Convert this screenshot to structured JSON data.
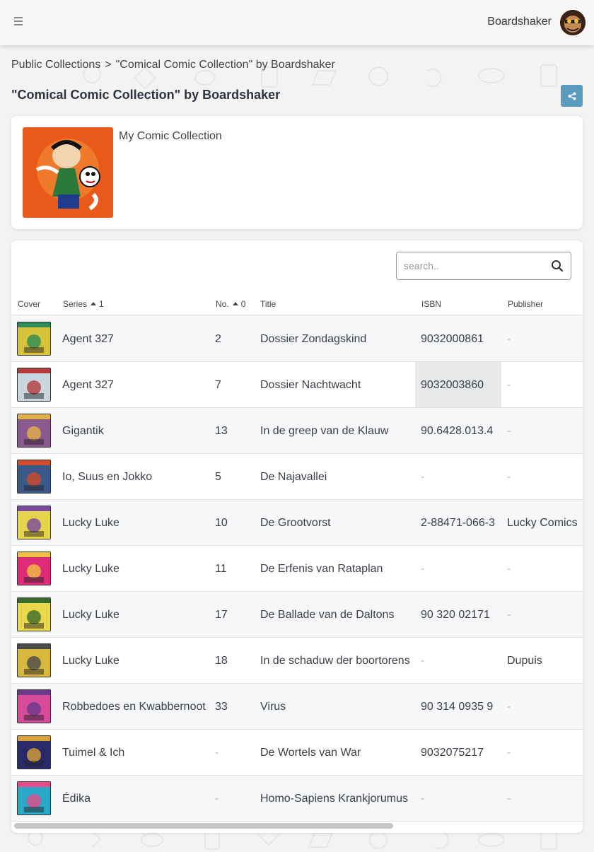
{
  "header": {
    "user_name": "Boardshaker"
  },
  "breadcrumb": {
    "root": "Public Collections",
    "separator": ">",
    "current": "\"Comical Comic Collection\" by Boardshaker"
  },
  "page": {
    "title": "\"Comical Comic Collection\" by Boardshaker",
    "description": "My Comic Collection"
  },
  "search": {
    "placeholder": "search..",
    "value": ""
  },
  "table": {
    "columns": {
      "cover": "Cover",
      "series": "Series",
      "series_sort_rank": "1",
      "number": "No.",
      "number_sort_rank": "0",
      "title": "Title",
      "isbn": "ISBN",
      "publisher": "Publisher"
    },
    "rows": [
      {
        "series": "Agent 327",
        "number": "2",
        "title": "Dossier Zondagskind",
        "isbn": "9032000861",
        "publisher": "-"
      },
      {
        "series": "Agent 327",
        "number": "7",
        "title": "Dossier Nachtwacht",
        "isbn": "9032003860",
        "publisher": "-"
      },
      {
        "series": "Gigantik",
        "number": "13",
        "title": "In de greep van de Klauw",
        "isbn": "90.6428.013.4",
        "publisher": "-"
      },
      {
        "series": "Io, Suus en Jokko",
        "number": "5",
        "title": "De Najavallei",
        "isbn": "-",
        "publisher": "-"
      },
      {
        "series": "Lucky Luke",
        "number": "10",
        "title": "De Grootvorst",
        "isbn": "2-88471-066-3",
        "publisher": "Lucky Comics"
      },
      {
        "series": "Lucky Luke",
        "number": "11",
        "title": "De Erfenis van Rataplan",
        "isbn": "-",
        "publisher": "-"
      },
      {
        "series": "Lucky Luke",
        "number": "17",
        "title": "De Ballade van de Daltons",
        "isbn": "90 320 02171",
        "publisher": "-"
      },
      {
        "series": "Lucky Luke",
        "number": "18",
        "title": "In de schaduw der boortorens",
        "isbn": "-",
        "publisher": "Dupuis"
      },
      {
        "series": "Robbedoes en Kwabbernoot",
        "number": "33",
        "title": "Virus",
        "isbn": "90 314 0935 9",
        "publisher": "-"
      },
      {
        "series": "Tuimel & Ich",
        "number": "-",
        "title": "De Wortels van War",
        "isbn": "9032075217",
        "publisher": "-"
      },
      {
        "series": "Édika",
        "number": "-",
        "title": "Homo-Sapiens Krankjorumus",
        "isbn": "-",
        "publisher": "-"
      }
    ]
  },
  "colors": {
    "share_button": "#5b9bbd",
    "page_background": "#f3f3f4",
    "row_alt": "#f6f7f8"
  },
  "icons": {
    "menu": "menu-icon",
    "share": "share-icon",
    "search": "search-icon"
  }
}
